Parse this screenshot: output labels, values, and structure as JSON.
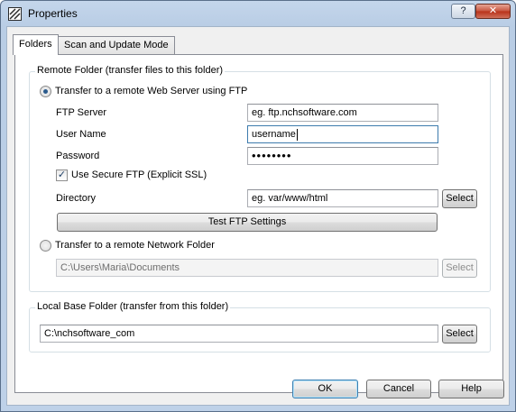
{
  "window": {
    "title": "Properties",
    "help_button": "?",
    "close_button": "✕"
  },
  "tabs": [
    {
      "label": "Folders",
      "active": true
    },
    {
      "label": "Scan and Update Mode",
      "active": false
    }
  ],
  "remote_folder": {
    "group_title": "Remote Folder (transfer files to this folder)",
    "ftp_radio_label": "Transfer to a remote Web Server using FTP",
    "ftp_radio_checked": true,
    "ftp_server_label": "FTP Server",
    "ftp_server_value": "eg. ftp.nchsoftware.com",
    "user_name_label": "User Name",
    "user_name_value": "username",
    "password_label": "Password",
    "password_value": "••••••••",
    "secure_ftp_label": "Use Secure FTP (Explicit SSL)",
    "secure_ftp_checked": true,
    "directory_label": "Directory",
    "directory_value": "eg. var/www/html",
    "directory_select": "Select",
    "test_button": "Test FTP Settings",
    "network_radio_label": "Transfer to a remote Network Folder",
    "network_radio_checked": false,
    "network_folder_value": "C:\\Users\\Maria\\Documents",
    "network_select": "Select"
  },
  "local_folder": {
    "group_title": "Local Base Folder (transfer from this folder)",
    "path_value": "C:\\nchsoftware_com",
    "select": "Select"
  },
  "footer": {
    "ok": "OK",
    "cancel": "Cancel",
    "help": "Help"
  },
  "colors": {
    "title_bar": "#b9cde5",
    "dialog_bg": "#f0f0f0",
    "close_button": "#c7533d",
    "focus_border": "#3d7bad"
  }
}
